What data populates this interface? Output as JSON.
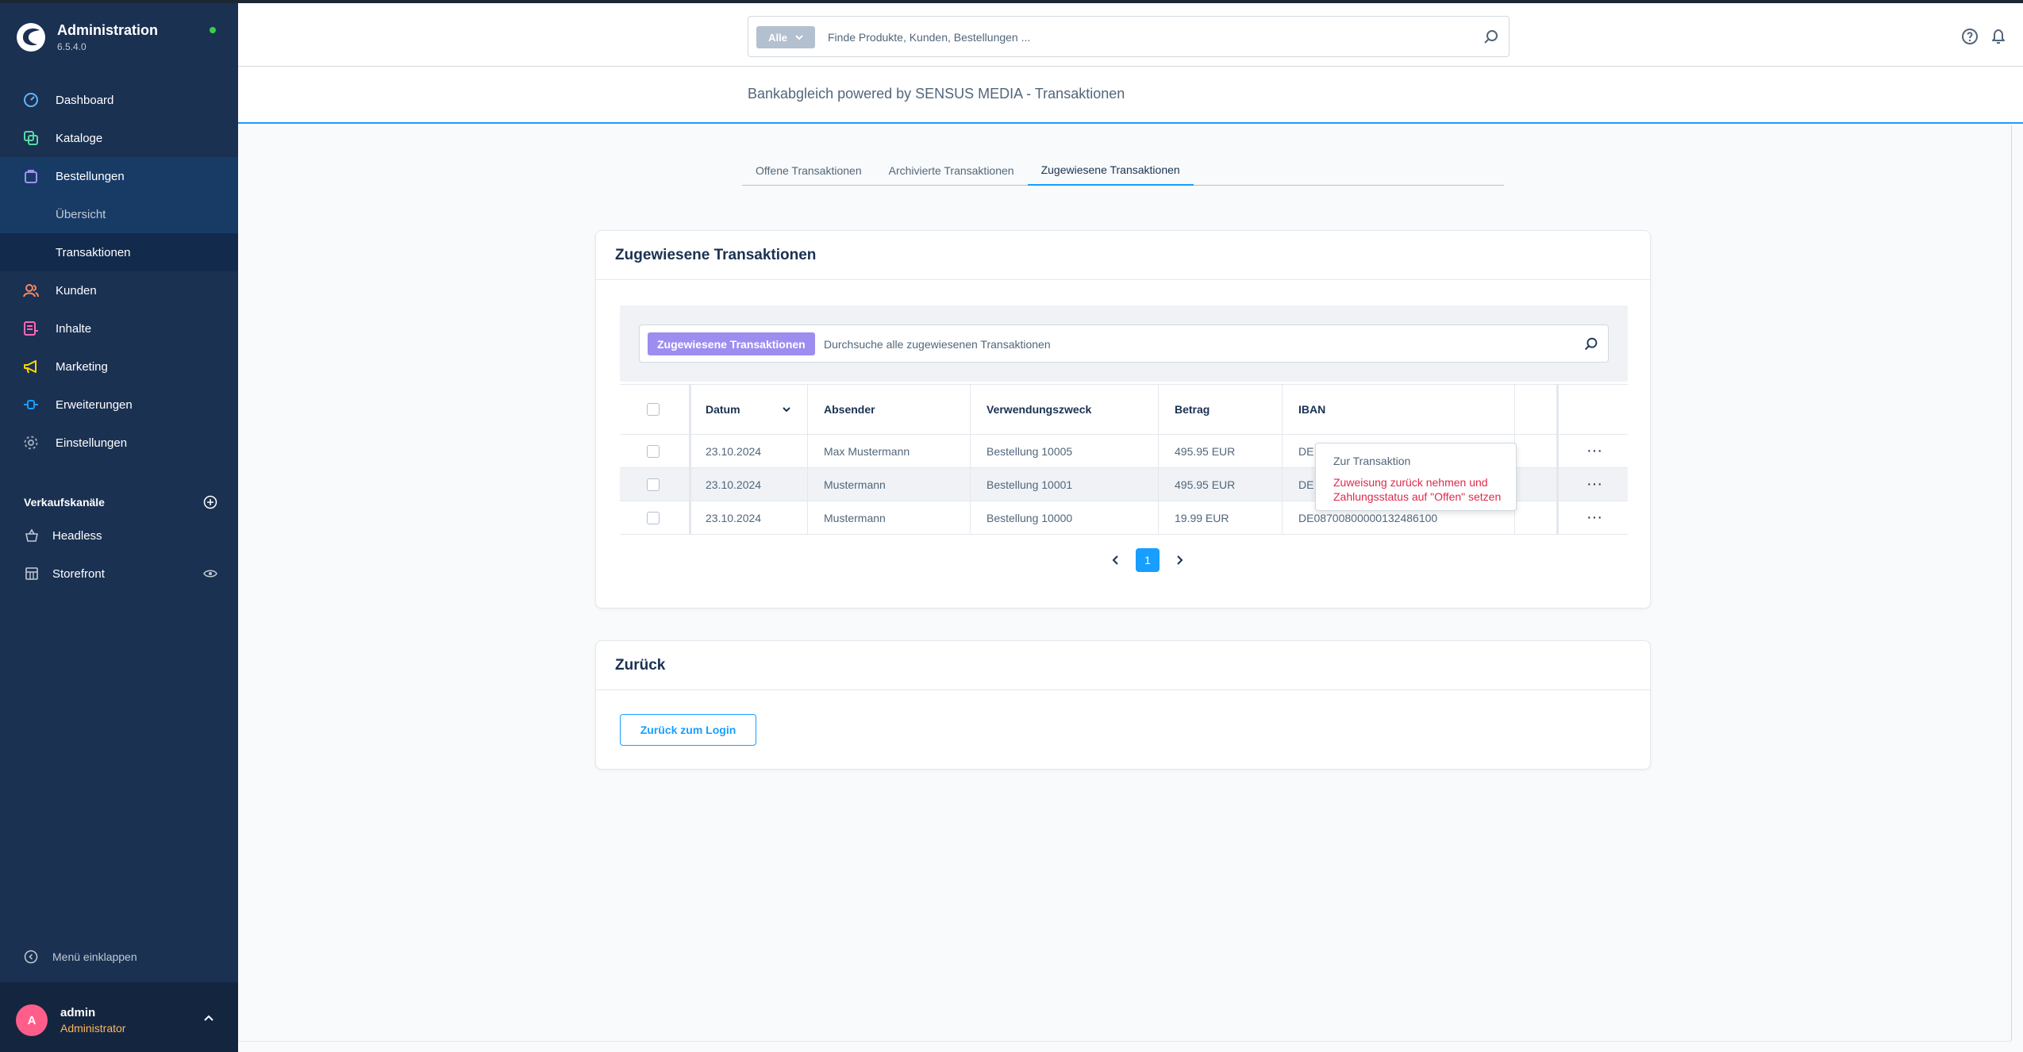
{
  "app": {
    "title": "Administration",
    "version": "6.5.4.0",
    "status_color": "#37d046"
  },
  "sidebar": {
    "items": [
      {
        "label": "Dashboard",
        "icon": "dashboard-icon",
        "color": "#63b3ff"
      },
      {
        "label": "Kataloge",
        "icon": "catalog-icon",
        "color": "#57d9a3"
      },
      {
        "label": "Bestellungen",
        "icon": "shopping-bag-icon",
        "color": "#a092f0"
      },
      {
        "label": "Kunden",
        "icon": "users-icon",
        "color": "#f88962"
      },
      {
        "label": "Inhalte",
        "icon": "content-icon",
        "color": "#ff68b4"
      },
      {
        "label": "Marketing",
        "icon": "megaphone-icon",
        "color": "#ffd700"
      },
      {
        "label": "Erweiterungen",
        "icon": "plug-icon",
        "color": "#189eff"
      },
      {
        "label": "Einstellungen",
        "icon": "gear-icon",
        "color": "#9aa8b5"
      }
    ],
    "subitems": [
      {
        "label": "Übersicht"
      },
      {
        "label": "Transaktionen"
      }
    ],
    "sales_channels": {
      "heading": "Verkaufskanäle",
      "items": [
        {
          "label": "Headless",
          "icon": "basket-icon"
        },
        {
          "label": "Storefront",
          "icon": "storefront-icon"
        }
      ]
    },
    "collapse_label": "Menü einklappen",
    "user": {
      "initial": "A",
      "name": "admin",
      "role": "Administrator"
    }
  },
  "header": {
    "search_type": "Alle",
    "search_placeholder": "Finde Produkte, Kunden, Bestellungen ..."
  },
  "page": {
    "title": "Bankabgleich powered by SENSUS MEDIA - Transaktionen"
  },
  "tabs": [
    {
      "label": "Offene Transaktionen"
    },
    {
      "label": "Archivierte Transaktionen"
    },
    {
      "label": "Zugewiesene Transaktionen"
    }
  ],
  "transactions_card": {
    "title": "Zugewiesene Transaktionen",
    "search_badge": "Zugewiesene Transaktionen",
    "search_placeholder": "Durchsuche alle zugewiesenen Transaktionen",
    "columns": {
      "date": "Datum",
      "sender": "Absender",
      "purpose": "Verwendungszweck",
      "amount": "Betrag",
      "iban": "IBAN"
    },
    "rows": [
      {
        "date": "23.10.2024",
        "sender": "Max Mustermann",
        "purpose": "Bestellung 10005",
        "amount": "495.95 EUR",
        "iban": "DE"
      },
      {
        "date": "23.10.2024",
        "sender": "Mustermann",
        "purpose": "Bestellung 10001",
        "amount": "495.95 EUR",
        "iban": "DE"
      },
      {
        "date": "23.10.2024",
        "sender": "Mustermann",
        "purpose": "Bestellung 10000",
        "amount": "19.99 EUR",
        "iban": "DE08700800000132486100"
      }
    ],
    "more_label": "···",
    "context_menu": {
      "item_view": "Zur Transaktion",
      "item_revert": "Zuweisung zurück nehmen und Zahlungsstatus auf \"Offen\" setzen"
    },
    "pagination": {
      "current_page": "1"
    }
  },
  "back_card": {
    "title": "Zurück",
    "button_label": "Zurück zum Login"
  }
}
